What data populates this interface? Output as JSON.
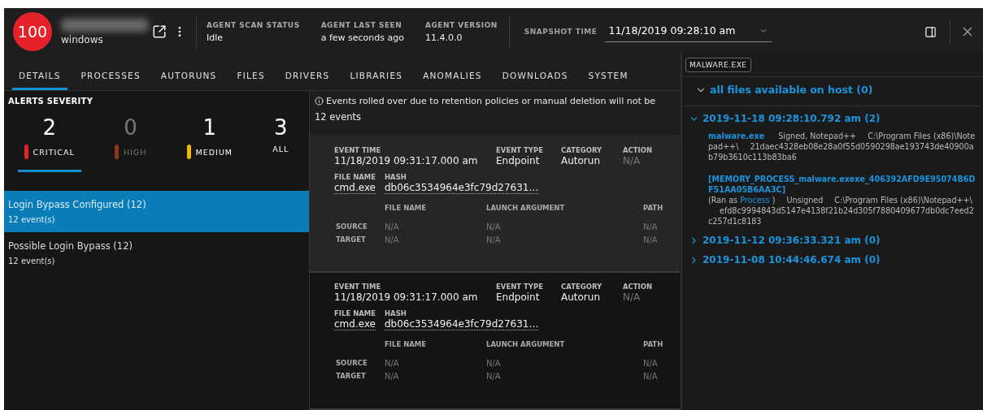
{
  "header": {
    "risk_score": "100",
    "os": "windows",
    "stats": [
      {
        "label": "AGENT SCAN STATUS",
        "value": "Idle"
      },
      {
        "label": "AGENT LAST SEEN",
        "value": "a few seconds ago"
      },
      {
        "label": "AGENT VERSION",
        "value": "11.4.0.0"
      }
    ],
    "snapshot": {
      "label": "SNAPSHOT TIME",
      "value": "11/18/2019 09:28:10 am"
    }
  },
  "tabs": [
    {
      "label": "DETAILS",
      "selected": true
    },
    {
      "label": "PROCESSES",
      "selected": false
    },
    {
      "label": "AUTORUNS",
      "selected": false
    },
    {
      "label": "FILES",
      "selected": false
    },
    {
      "label": "DRIVERS",
      "selected": false
    },
    {
      "label": "LIBRARIES",
      "selected": false
    },
    {
      "label": "ANOMALIES",
      "selected": false
    },
    {
      "label": "DOWNLOADS",
      "selected": false
    },
    {
      "label": "SYSTEM",
      "selected": false
    }
  ],
  "severity": {
    "title": "ALERTS SEVERITY",
    "levels": [
      {
        "count": "2",
        "label": "CRITICAL",
        "color": "#e5222a",
        "selected": true,
        "disabled": false
      },
      {
        "count": "0",
        "label": "HIGH",
        "color": "#8a3a1c",
        "selected": false,
        "disabled": true
      },
      {
        "count": "1",
        "label": "MEDIUM",
        "color": "#f3b800",
        "selected": false,
        "disabled": false
      },
      {
        "count": "3",
        "label": "ALL",
        "selected": false,
        "disabled": false
      }
    ]
  },
  "alerts": [
    {
      "name": "Login Bypass Configured (12)",
      "events": "12 event(s)",
      "selected": true
    },
    {
      "name": "Possible Login Bypass (12)",
      "events": "12 event(s)",
      "selected": false
    }
  ],
  "events": {
    "notice": "Events rolled over due to retention policies or manual deletion will not be",
    "count": "12 events",
    "cards": [
      {
        "selected": true,
        "fields": [
          {
            "label": "EVENT TIME",
            "value": "11/18/2019 09:31:17.000 am",
            "muted": false
          },
          {
            "label": "EVENT TYPE",
            "value": "Endpoint",
            "muted": false
          },
          {
            "label": "CATEGORY",
            "value": "Autorun",
            "muted": false
          },
          {
            "label": "ACTION",
            "value": "N/A",
            "muted": true
          }
        ],
        "file": [
          {
            "label": "FILE NAME",
            "value": "cmd.exe"
          },
          {
            "label": "HASH",
            "value": "db06c3534964e3fc79d27631…"
          }
        ],
        "table": {
          "columns": [
            "FILE NAME",
            "LAUNCH ARGUMENT",
            "PATH"
          ],
          "rows": [
            {
              "label": "SOURCE",
              "cells": [
                "N/A",
                "N/A",
                "N/A"
              ]
            },
            {
              "label": "TARGET",
              "cells": [
                "N/A",
                "N/A",
                "N/A"
              ]
            }
          ]
        }
      },
      {
        "selected": false,
        "fields": [
          {
            "label": "EVENT TIME",
            "value": "11/18/2019 09:31:17.000 am",
            "muted": false
          },
          {
            "label": "EVENT TYPE",
            "value": "Endpoint",
            "muted": false
          },
          {
            "label": "CATEGORY",
            "value": "Autorun",
            "muted": false
          },
          {
            "label": "ACTION",
            "value": "N/A",
            "muted": true
          }
        ],
        "file": [
          {
            "label": "FILE NAME",
            "value": "cmd.exe"
          },
          {
            "label": "HASH",
            "value": "db06c3534964e3fc79d27631…"
          }
        ],
        "table": {
          "columns": [
            "FILE NAME",
            "LAUNCH ARGUMENT",
            "PATH"
          ],
          "rows": [
            {
              "label": "SOURCE",
              "cells": [
                "N/A",
                "N/A",
                "N/A"
              ]
            },
            {
              "label": "TARGET",
              "cells": [
                "N/A",
                "N/A",
                "N/A"
              ]
            }
          ]
        }
      }
    ]
  },
  "side_panel": {
    "chip": "MALWARE.EXE",
    "root": {
      "title": "all files available on host (0)",
      "expanded": true
    },
    "groups": [
      {
        "title": "2019-11-18 09:28:10.792 am (2)",
        "expanded": true,
        "files": [
          {
            "name": "malware.exe",
            "signature": "Signed, Notepad++",
            "path": "C:\\Program Files (x86)\\Notepad++\\",
            "hash": "21daec4328eb08e28a0f55d0590298ae193743de40900ab79b3610c113b83ba6"
          },
          {
            "name": "[MEMORY_PROCESS_malware.exexe_406392AFD9E95074B6DF51AA05B6AA3C]",
            "ran_as": [
              "(Ran as",
              "Process",
              ")"
            ],
            "signature": "Unsigned",
            "path": "C:\\Program Files (x86)\\Notepad++\\",
            "hash": "efd8c9994843d5147e4138f21b24d305f7880409677db0dc7eed2c257d1c8183"
          }
        ]
      },
      {
        "title": "2019-11-12 09:36:33.321 am (0)",
        "expanded": false
      },
      {
        "title": "2019-11-08 10:44:46.674 am (0)",
        "expanded": false
      }
    ]
  }
}
